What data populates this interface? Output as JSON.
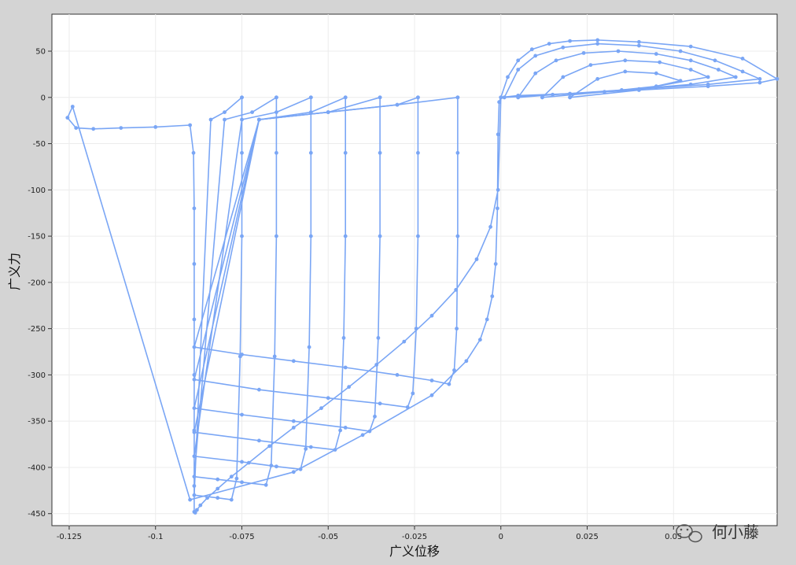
{
  "chart_data": {
    "type": "scatter",
    "subtype": "line-with-markers",
    "xlabel": "广义位移",
    "ylabel": "广义力",
    "xlim": [
      -0.13,
      0.08
    ],
    "ylim": [
      -463,
      90
    ],
    "xticks": [
      -0.125,
      -0.1,
      -0.075,
      -0.05,
      -0.025,
      0,
      0.025,
      0.05
    ],
    "xtick_labels": [
      "-0.125",
      "-0.1",
      "-0.075",
      "-0.05",
      "-0.025",
      "0",
      "0.025",
      "0.05"
    ],
    "yticks": [
      50,
      0,
      -50,
      -100,
      -150,
      -200,
      -250,
      -300,
      -350,
      -400,
      -450
    ],
    "ytick_labels": [
      "50",
      "0",
      "-50",
      "-100",
      "-150",
      "-200",
      "-250",
      "-300",
      "-350",
      "-400",
      "-450"
    ],
    "grid": true,
    "legend": "none",
    "series_color": "#7aa6f5",
    "series": [
      {
        "x": [
          0.0,
          -0.0005,
          -0.0008,
          -0.001,
          -0.0015,
          -0.0025,
          -0.004,
          -0.006,
          -0.01,
          -0.02,
          -0.04,
          -0.06,
          -0.09,
          -0.124,
          -0.1255,
          -0.123,
          -0.118,
          -0.11,
          -0.1,
          -0.09,
          -0.089,
          -0.0888,
          -0.0888,
          -0.0888,
          -0.0888,
          -0.0888,
          -0.0888,
          -0.0888,
          -0.0885,
          -0.088,
          -0.087,
          -0.085,
          -0.082,
          -0.078,
          -0.073,
          -0.067,
          -0.06,
          -0.052,
          -0.044,
          -0.036,
          -0.028,
          -0.02,
          -0.013,
          -0.007,
          -0.003,
          -0.0008,
          0.0,
          0.002,
          0.005,
          0.009,
          0.014,
          0.02,
          0.028,
          0.04,
          0.055,
          0.07,
          0.08,
          0.075,
          0.06,
          0.04,
          0.02,
          0.005,
          0.0
        ],
        "y": [
          0,
          -5,
          -40,
          -120,
          -180,
          -215,
          -240,
          -262,
          -285,
          -322,
          -365,
          -405,
          -435,
          -10,
          -22,
          -33,
          -34,
          -33,
          -32,
          -30,
          -60,
          -120,
          -180,
          -240,
          -300,
          -360,
          -420,
          -448,
          -449,
          -446,
          -441,
          -433,
          -423,
          -410,
          -395,
          -377,
          -357,
          -336,
          -313,
          -289,
          -264,
          -236,
          -208,
          -175,
          -140,
          -100,
          0,
          22,
          40,
          52,
          58,
          61,
          62,
          60,
          55,
          42,
          20,
          16,
          12,
          8,
          4,
          2,
          0
        ]
      },
      {
        "x": [
          -0.0125,
          -0.0125,
          -0.0125,
          -0.0128,
          -0.0135,
          -0.015,
          -0.02,
          -0.03,
          -0.045,
          -0.06,
          -0.075,
          -0.0888,
          -0.07,
          -0.05,
          -0.03,
          -0.0125
        ],
        "y": [
          0,
          -60,
          -150,
          -250,
          -295,
          -310,
          -306,
          -300,
          -292,
          -285,
          -278,
          -270,
          -24,
          -16,
          -8,
          0
        ]
      },
      {
        "x": [
          -0.024,
          -0.024,
          -0.024,
          -0.0245,
          -0.0255,
          -0.027,
          -0.035,
          -0.05,
          -0.07,
          -0.0888,
          -0.07,
          -0.05,
          -0.03,
          -0.024
        ],
        "y": [
          0,
          -60,
          -150,
          -250,
          -320,
          -335,
          -331,
          -325,
          -316,
          -305,
          -24,
          -16,
          -8,
          0
        ]
      },
      {
        "x": [
          -0.035,
          -0.035,
          -0.035,
          -0.0355,
          -0.0365,
          -0.038,
          -0.045,
          -0.06,
          -0.075,
          -0.0888,
          -0.07,
          -0.05,
          -0.035
        ],
        "y": [
          0,
          -60,
          -150,
          -260,
          -345,
          -361,
          -357,
          -350,
          -343,
          -336,
          -24,
          -16,
          0
        ]
      },
      {
        "x": [
          -0.045,
          -0.045,
          -0.045,
          -0.0455,
          -0.0465,
          -0.048,
          -0.055,
          -0.07,
          -0.0888,
          -0.07,
          -0.055,
          -0.045
        ],
        "y": [
          0,
          -60,
          -150,
          -260,
          -360,
          -381,
          -378,
          -371,
          -362,
          -24,
          -16,
          0
        ]
      },
      {
        "x": [
          -0.055,
          -0.055,
          -0.055,
          -0.0555,
          -0.0565,
          -0.058,
          -0.065,
          -0.075,
          -0.0888,
          -0.075,
          -0.065,
          -0.055
        ],
        "y": [
          0,
          -60,
          -150,
          -270,
          -380,
          -402,
          -399,
          -394,
          -388,
          -24,
          -16,
          0
        ]
      },
      {
        "x": [
          -0.065,
          -0.065,
          -0.065,
          -0.0655,
          -0.0665,
          -0.068,
          -0.075,
          -0.082,
          -0.0888,
          -0.08,
          -0.072,
          -0.065
        ],
        "y": [
          0,
          -60,
          -150,
          -280,
          -398,
          -419,
          -416,
          -413,
          -410,
          -24,
          -16,
          0
        ]
      },
      {
        "x": [
          -0.075,
          -0.075,
          -0.075,
          -0.0755,
          -0.0765,
          -0.078,
          -0.082,
          -0.0888,
          -0.084,
          -0.08,
          -0.075
        ],
        "y": [
          0,
          -60,
          -150,
          -280,
          -412,
          -435,
          -433,
          -430,
          -24,
          -16,
          0
        ]
      },
      {
        "x": [
          0.001,
          0.005,
          0.01,
          0.018,
          0.028,
          0.04,
          0.052,
          0.062,
          0.07,
          0.075,
          0.06,
          0.04,
          0.02,
          0.001
        ],
        "y": [
          0,
          30,
          45,
          54,
          58,
          56,
          50,
          40,
          28,
          20,
          14,
          9,
          4,
          0
        ]
      },
      {
        "x": [
          0.005,
          0.01,
          0.016,
          0.024,
          0.034,
          0.045,
          0.055,
          0.063,
          0.068,
          0.055,
          0.035,
          0.015,
          0.005
        ],
        "y": [
          0,
          26,
          40,
          48,
          50,
          47,
          40,
          30,
          22,
          14,
          8,
          3,
          0
        ]
      },
      {
        "x": [
          0.012,
          0.018,
          0.026,
          0.036,
          0.046,
          0.055,
          0.06,
          0.045,
          0.03,
          0.012
        ],
        "y": [
          0,
          22,
          35,
          40,
          38,
          30,
          22,
          12,
          6,
          0
        ]
      },
      {
        "x": [
          0.02,
          0.028,
          0.036,
          0.045,
          0.052,
          0.04,
          0.02
        ],
        "y": [
          0,
          20,
          28,
          26,
          18,
          8,
          0
        ]
      }
    ]
  }
}
